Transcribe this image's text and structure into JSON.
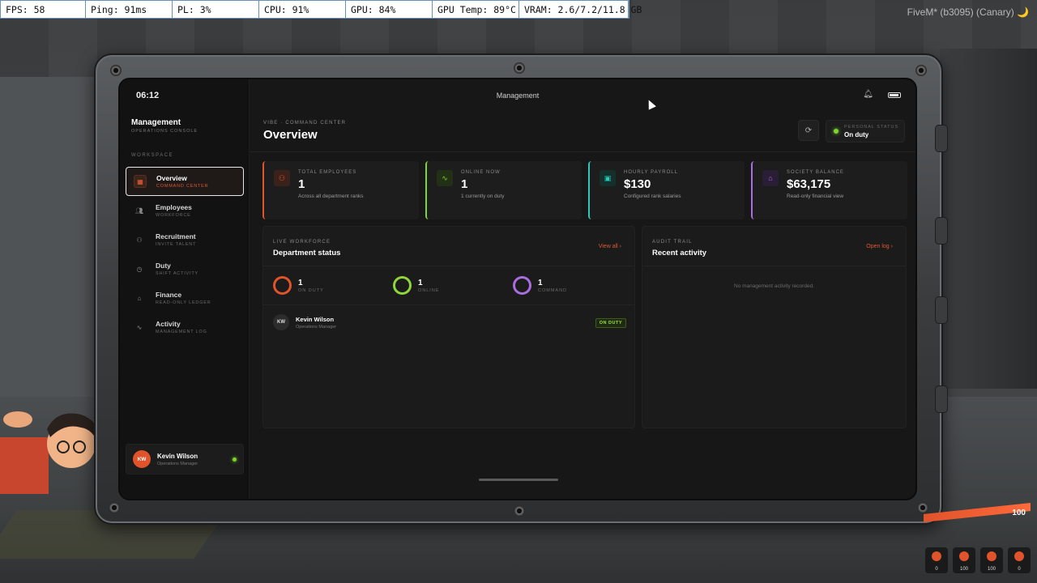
{
  "perf": {
    "fps": "FPS: 58",
    "ping": "Ping: 91ms",
    "pl": "PL: 3%",
    "cpu": "CPU: 91%",
    "gpu": "GPU: 84%",
    "gpu_temp": "GPU Temp: 89°C",
    "vram": "VRAM: 2.6/7.2/11.8 GB"
  },
  "watermark": "FiveM* (b3095) (Canary) 🌙",
  "tablet": {
    "clock": "06:12",
    "top_title": "Management",
    "icons": {
      "bell": "bell-icon",
      "battery": "battery-icon"
    }
  },
  "sidebar": {
    "brand_title": "Management",
    "brand_sub": "OPERATIONS CONSOLE",
    "section": "WORKSPACE",
    "items": [
      {
        "label": "Overview",
        "sub": "COMMAND CENTER",
        "icon": "grid-icon",
        "active": true
      },
      {
        "label": "Employees",
        "sub": "WORKFORCE",
        "icon": "users-icon"
      },
      {
        "label": "Recruitment",
        "sub": "INVITE TALENT",
        "icon": "user-plus-icon"
      },
      {
        "label": "Duty",
        "sub": "SHIFT ACTIVITY",
        "icon": "clock-icon"
      },
      {
        "label": "Finance",
        "sub": "READ-ONLY LEDGER",
        "icon": "bank-icon"
      },
      {
        "label": "Activity",
        "sub": "MANAGEMENT LOG",
        "icon": "pulse-icon"
      }
    ],
    "user": {
      "initials": "KW",
      "name": "Kevin Wilson",
      "role": "Operations Manager"
    }
  },
  "header": {
    "kicker": "VIBE · COMMAND CENTER",
    "title": "Overview",
    "status_label": "PERSONAL STATUS",
    "status_value": "On duty"
  },
  "stats": [
    {
      "label": "TOTAL EMPLOYEES",
      "value": "1",
      "caption": "Across all department ranks",
      "color": "#e0532b",
      "icon": "users-icon"
    },
    {
      "label": "ONLINE NOW",
      "value": "1",
      "caption": "1 currently on duty",
      "color": "#7dd62d",
      "icon": "pulse-icon"
    },
    {
      "label": "HOURLY PAYROLL",
      "value": "$130",
      "caption": "Configured rank salaries",
      "color": "#2ec9b4",
      "icon": "cash-icon"
    },
    {
      "label": "SOCIETY BALANCE",
      "value": "$63,175",
      "caption": "Read-only financial view",
      "color": "#a86ee0",
      "icon": "bank-icon"
    }
  ],
  "workforce": {
    "kicker": "LIVE WORKFORCE",
    "title": "Department status",
    "link": "View all",
    "rings": [
      {
        "value": "1",
        "label": "ON DUTY",
        "color": "#e0532b"
      },
      {
        "value": "1",
        "label": "ONLINE",
        "color": "#8fd63a"
      },
      {
        "value": "1",
        "label": "COMMAND",
        "color": "#a86ee0"
      }
    ],
    "employee": {
      "initials": "KW",
      "name": "Kevin Wilson",
      "role": "Operations Manager",
      "badge": "ON DUTY"
    }
  },
  "audit": {
    "kicker": "AUDIT TRAIL",
    "title": "Recent activity",
    "link": "Open log",
    "empty": "No management activity recorded."
  },
  "hud": {
    "health": "100",
    "items": [
      {
        "value": "0",
        "icon": "hunger-icon"
      },
      {
        "value": "100",
        "icon": "food-icon"
      },
      {
        "value": "100",
        "icon": "water-icon"
      },
      {
        "value": "0",
        "icon": "shield-icon"
      }
    ]
  }
}
